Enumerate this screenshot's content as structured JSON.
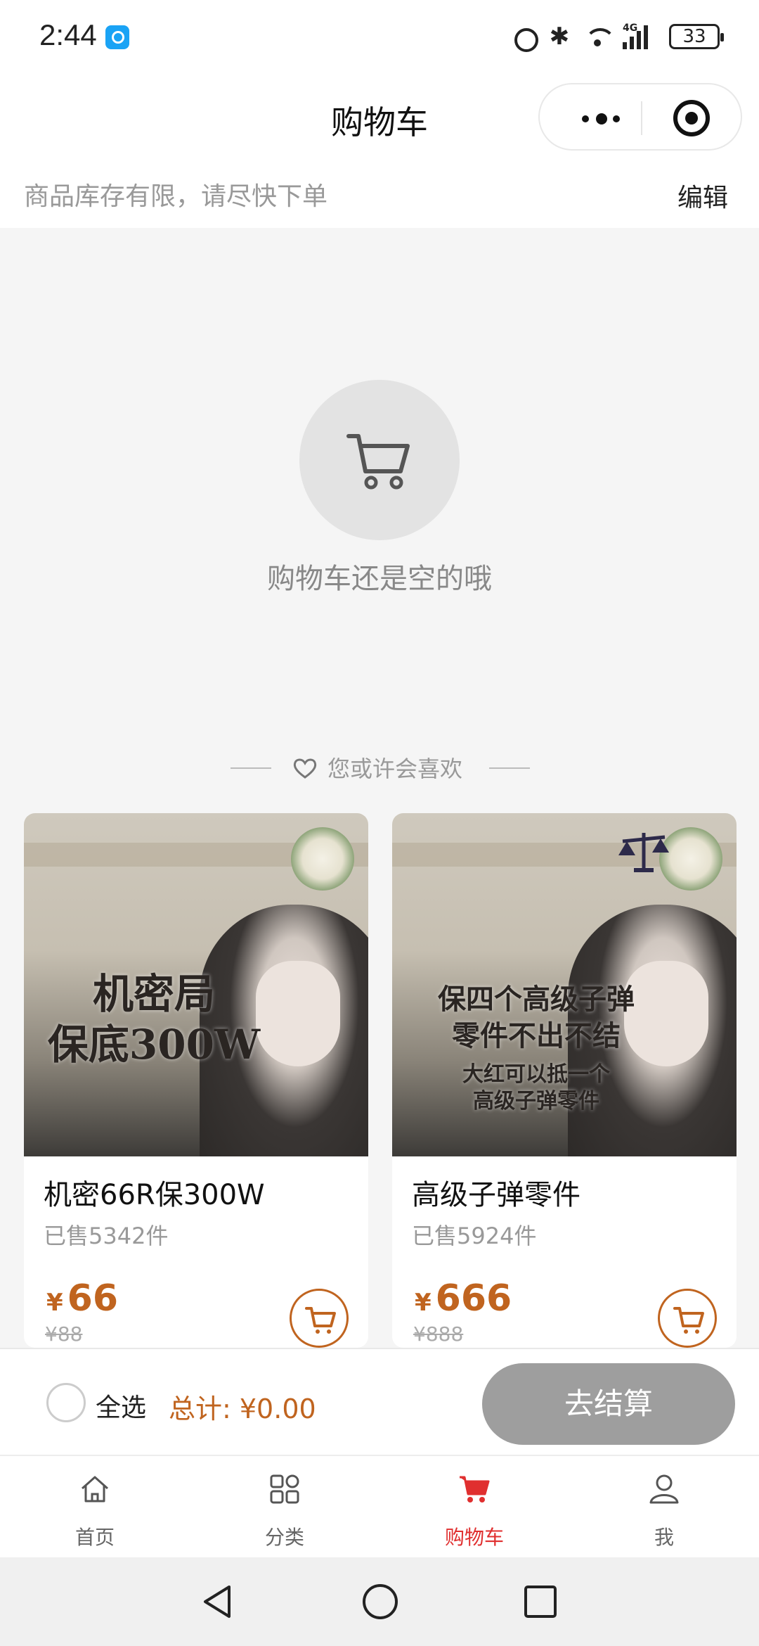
{
  "status_bar": {
    "time": "2:44",
    "battery": "33",
    "network": "4G"
  },
  "navbar": {
    "title": "购物车"
  },
  "tip": {
    "text": "商品库存有限，请尽快下单",
    "edit": "编辑"
  },
  "empty": {
    "text": "购物车还是空的哦"
  },
  "recommend": {
    "title": "您或许会喜欢",
    "products": [
      {
        "name": "机密66R保300W",
        "sold": "已售5342件",
        "currency": "¥",
        "price": "66",
        "original": "¥88",
        "image_text": [
          "机密局",
          "保底300W"
        ]
      },
      {
        "name": "高级子弹零件",
        "sold": "已售5924件",
        "currency": "¥",
        "price": "666",
        "original": "¥888",
        "image_text": [
          "保四个高级子弹",
          "零件不出不结",
          "大红可以抵一个",
          "高级子弹零件"
        ]
      }
    ]
  },
  "checkout": {
    "select_all": "全选",
    "total": "总计: ¥0.00",
    "button": "去结算"
  },
  "tabbar": {
    "items": [
      {
        "label": "首页",
        "icon": "home-icon"
      },
      {
        "label": "分类",
        "icon": "category-icon"
      },
      {
        "label": "购物车",
        "icon": "cart-icon"
      },
      {
        "label": "我",
        "icon": "user-icon"
      }
    ]
  },
  "colors": {
    "accent": "#c0641f",
    "active_tab": "#e02f2f",
    "checkout_btn": "#9e9e9e"
  }
}
